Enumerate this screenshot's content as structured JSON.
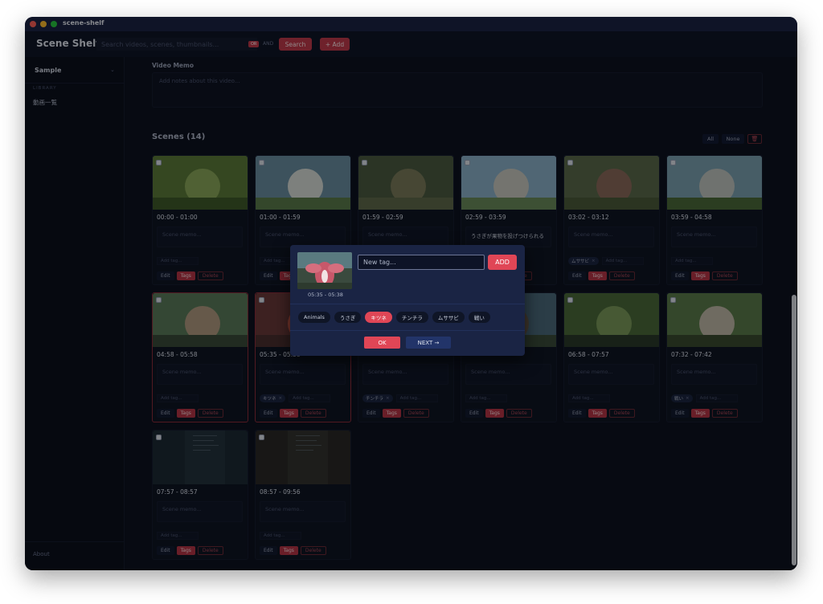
{
  "window": {
    "app_name": "scene-shelf"
  },
  "header": {
    "brand": "Scene Shelf",
    "search_placeholder": "Search videos, scenes, thumbnails...",
    "or_badge": "OR",
    "and_label": "AND",
    "search_button": "Search",
    "add_button": "+ Add"
  },
  "sidebar": {
    "sample": "Sample",
    "library_heading": "LIBRARY",
    "items": [
      "動画一覧"
    ],
    "about": "About"
  },
  "main": {
    "memo_label": "Video Memo",
    "memo_placeholder": "Add notes about this video...",
    "scenes_title": "Scenes (14)",
    "all_button": "All",
    "none_button": "None",
    "scene_memo_placeholder": "Scene memo...",
    "add_tag_placeholder": "Add tag...",
    "edit_label": "Edit",
    "tags_label": "Tags",
    "delete_label": "Delete"
  },
  "scenes": [
    {
      "range": "00:00 - 01:00",
      "memo": "",
      "tags": [],
      "selected": false
    },
    {
      "range": "01:00 - 01:59",
      "memo": "",
      "tags": [],
      "selected": false
    },
    {
      "range": "01:59 - 02:59",
      "memo": "",
      "tags": [],
      "selected": false
    },
    {
      "range": "02:59 - 03:59",
      "memo": "うさぎが果物を投げつけられる",
      "tags": [],
      "selected": false
    },
    {
      "range": "03:02 - 03:12",
      "memo": "",
      "tags": [
        "ムササビ"
      ],
      "selected": false
    },
    {
      "range": "03:59 - 04:58",
      "memo": "",
      "tags": [],
      "selected": false
    },
    {
      "range": "04:58 - 05:58",
      "memo": "",
      "tags": [],
      "selected": true
    },
    {
      "range": "05:35 - 05:38",
      "memo": "",
      "tags": [
        "キツネ"
      ],
      "selected": true
    },
    {
      "range": "",
      "memo": "",
      "tags": [
        "チンチラ"
      ],
      "selected": false
    },
    {
      "range": "",
      "memo": "",
      "tags": [],
      "selected": false
    },
    {
      "range": "06:58 - 07:57",
      "memo": "",
      "tags": [],
      "selected": false
    },
    {
      "range": "07:32 - 07:42",
      "memo": "",
      "tags": [
        "戦い"
      ],
      "selected": false
    },
    {
      "range": "07:57 - 08:57",
      "memo": "",
      "tags": [],
      "selected": false
    },
    {
      "range": "08:57 - 09:56",
      "memo": "",
      "tags": [],
      "selected": false
    }
  ],
  "modal": {
    "time": "05:35 - 05:38",
    "input_placeholder": "New tag...",
    "add_button": "ADD",
    "tags": [
      {
        "label": "Animals",
        "active": false
      },
      {
        "label": "うさぎ",
        "active": false
      },
      {
        "label": "キツネ",
        "active": true
      },
      {
        "label": "チンチラ",
        "active": false
      },
      {
        "label": "ムササビ",
        "active": false
      },
      {
        "label": "戦い",
        "active": false
      }
    ],
    "ok_button": "OK",
    "next_button": "NEXT →"
  },
  "colors": {
    "accent": "#e04656",
    "background": "#0d1220",
    "modal": "#1a2444"
  }
}
